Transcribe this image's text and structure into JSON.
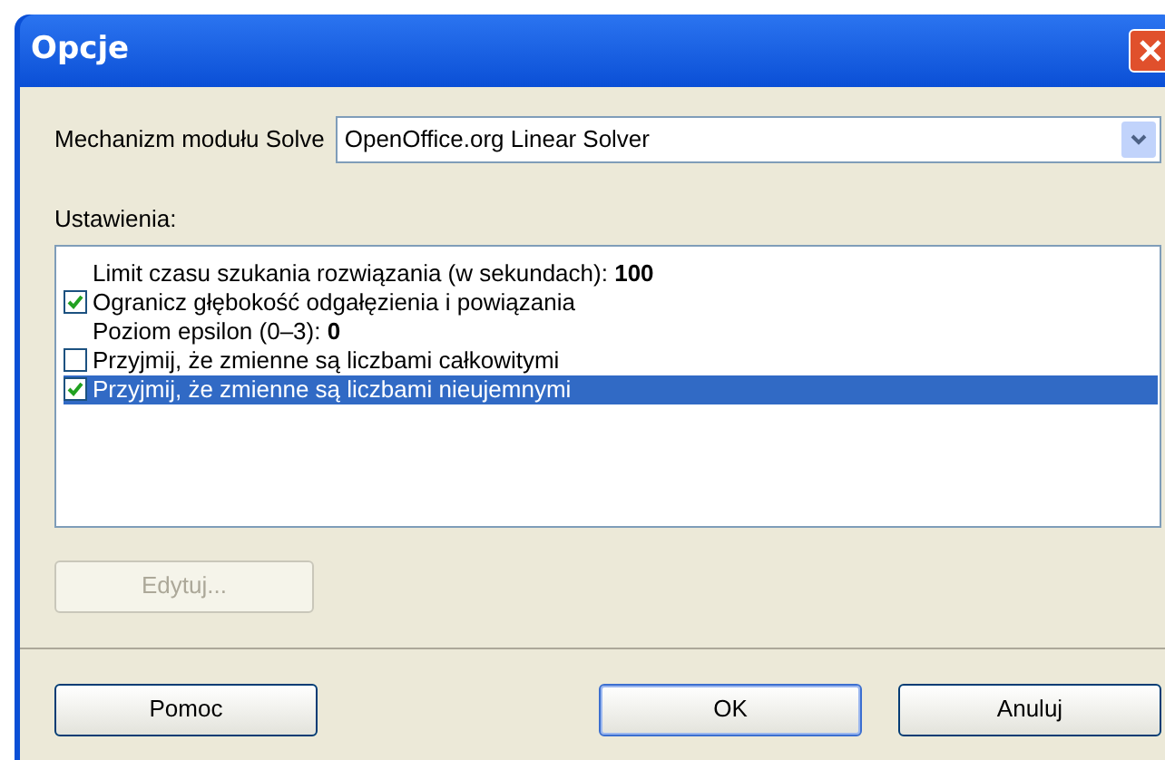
{
  "window": {
    "title": "Opcje"
  },
  "engine": {
    "label": "Mechanizm modułu Solve",
    "value": "OpenOffice.org Linear Solver"
  },
  "settings": {
    "label": "Ustawienia:",
    "items": [
      {
        "kind": "value",
        "label": "Limit czasu szukania rozwiązania (w sekundach):",
        "value": "100",
        "selected": false
      },
      {
        "kind": "checkbox",
        "label": "Ogranicz głębokość odgałęzienia i powiązania",
        "checked": true,
        "selected": false
      },
      {
        "kind": "value",
        "label": "Poziom epsilon (0–3):",
        "value": "0",
        "selected": false
      },
      {
        "kind": "checkbox",
        "label": "Przyjmij, że zmienne są liczbami całkowitymi",
        "checked": false,
        "selected": false
      },
      {
        "kind": "checkbox",
        "label": "Przyjmij, że zmienne są liczbami nieujemnymi",
        "checked": true,
        "selected": true
      }
    ]
  },
  "edit_button": {
    "label": "Edytuj...",
    "disabled": true
  },
  "buttons": [
    {
      "label": "Pomoc",
      "default": false
    },
    {
      "label": "OK",
      "default": true
    },
    {
      "label": "Anuluj",
      "default": false
    }
  ]
}
